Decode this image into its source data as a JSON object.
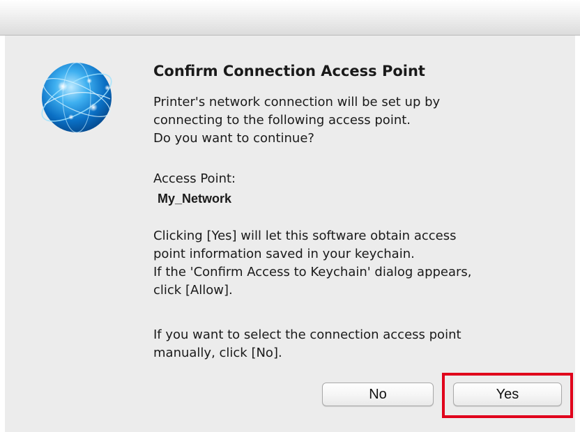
{
  "dialog": {
    "title": "Confirm Connection Access Point",
    "message_lines": [
      "Printer's network connection will be set up by",
      "connecting to the following access point.",
      "Do you want to continue?"
    ],
    "access_point_label": "Access Point:",
    "access_point_value": "My_Network",
    "keychain_lines": [
      "Clicking [Yes] will let this software obtain access",
      "point information saved in your keychain.",
      "If the 'Confirm Access to Keychain' dialog appears,",
      "click [Allow]."
    ],
    "manual_lines": [
      "If you want to select the connection access point",
      "manually, click [No]."
    ],
    "icon": "globe-network-icon"
  },
  "buttons": {
    "no_label": "No",
    "yes_label": "Yes"
  },
  "colors": {
    "highlight": "#e0001b",
    "dialog_background": "#ececec"
  }
}
